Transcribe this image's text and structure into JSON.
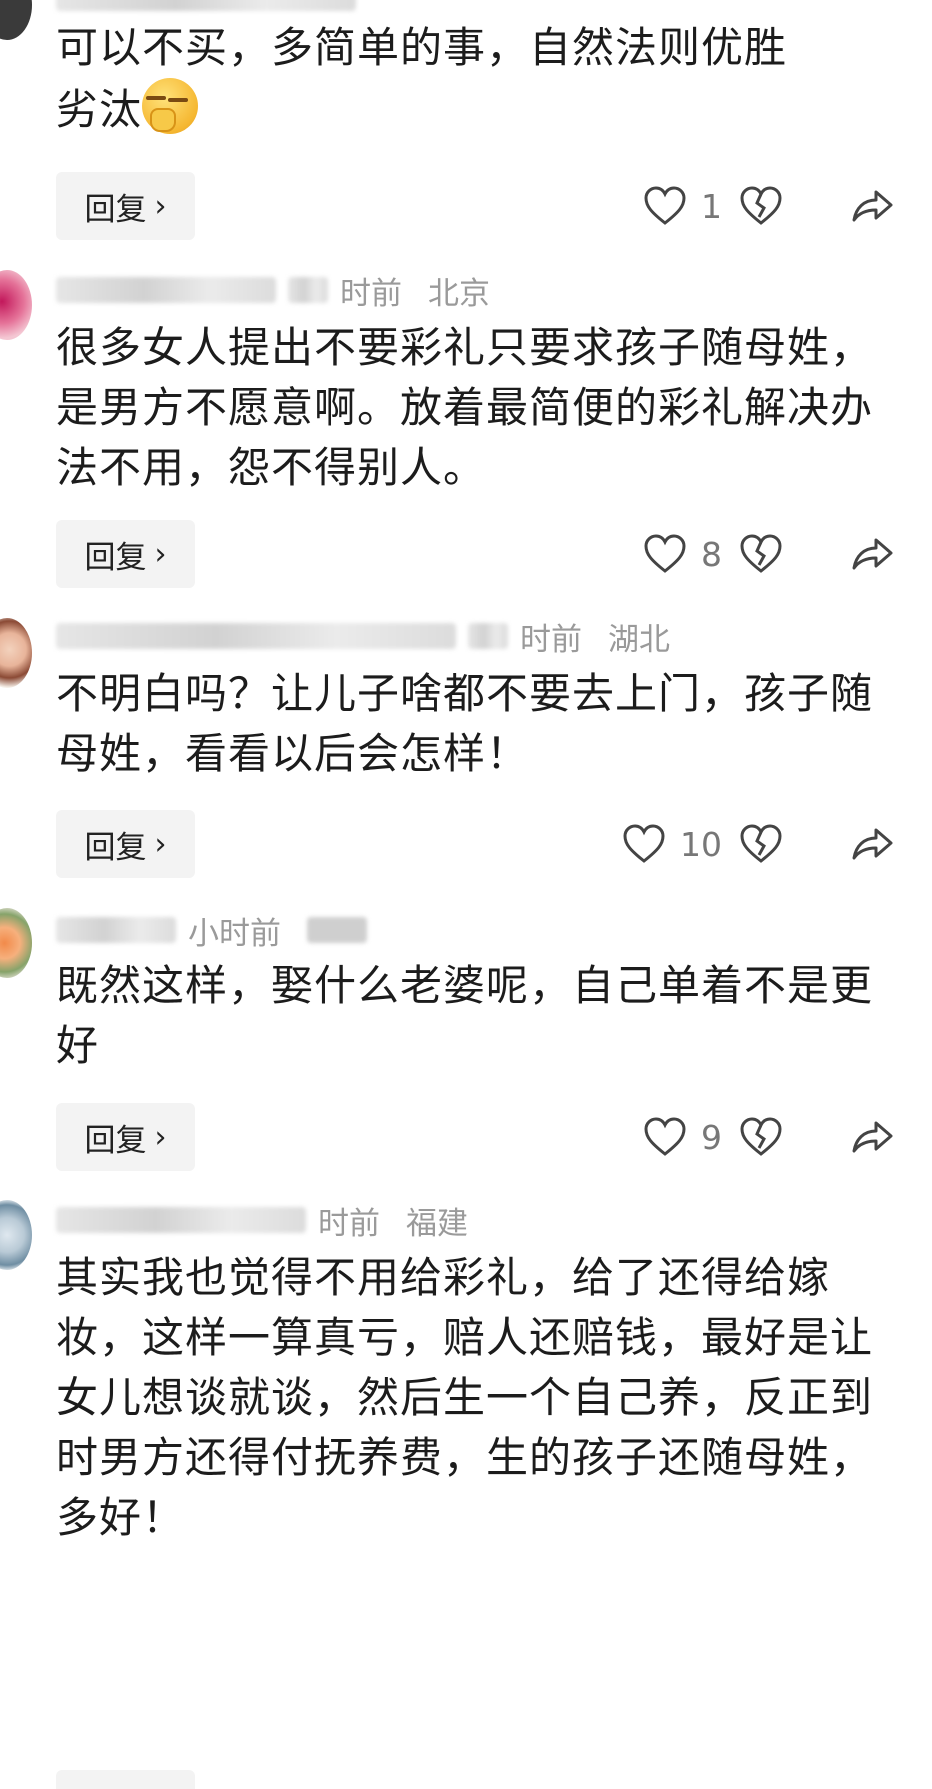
{
  "reply_label": "回复",
  "comments": [
    {
      "meta_text": "",
      "location": "",
      "text_line1": "可以不买，多简单的事，自然法则优胜",
      "text_line2": "劣汰",
      "likes": "1",
      "icons": {
        "like": "heart-outline-icon",
        "unlike": "broken-heart-icon",
        "share": "share-arrow-icon",
        "chevron": "chevron-right-icon",
        "emoji": "smirk-emoji-icon"
      }
    },
    {
      "time": "时前",
      "location": "北京",
      "text": "很多女人提出不要彩礼只要求孩子随母姓，是男方不愿意啊。放着最简便的彩礼解决办法不用，怨不得别人。",
      "likes": "8"
    },
    {
      "time": "时前",
      "location": "湖北",
      "text": "不明白吗？让儿子啥都不要去上门，孩子随母姓，看看以后会怎样！",
      "likes": "10"
    },
    {
      "time": "小时前",
      "location": "",
      "text": "既然这样，娶什么老婆呢，自己单着不是更好",
      "likes": "9"
    },
    {
      "time": "时前",
      "location": "福建",
      "text": "其实我也觉得不用给彩礼，给了还得给嫁妆，这样一算真亏，赔人还赔钱，最好是让女儿想谈就谈，然后生一个自己养，反正到时男方还得付抚养费，生的孩子还随母姓，多好！"
    }
  ],
  "colors": {
    "text": "#1c1c1c",
    "meta": "#9a9a9a",
    "icon": "#444444",
    "reply_bg": "#f3f3f3"
  }
}
